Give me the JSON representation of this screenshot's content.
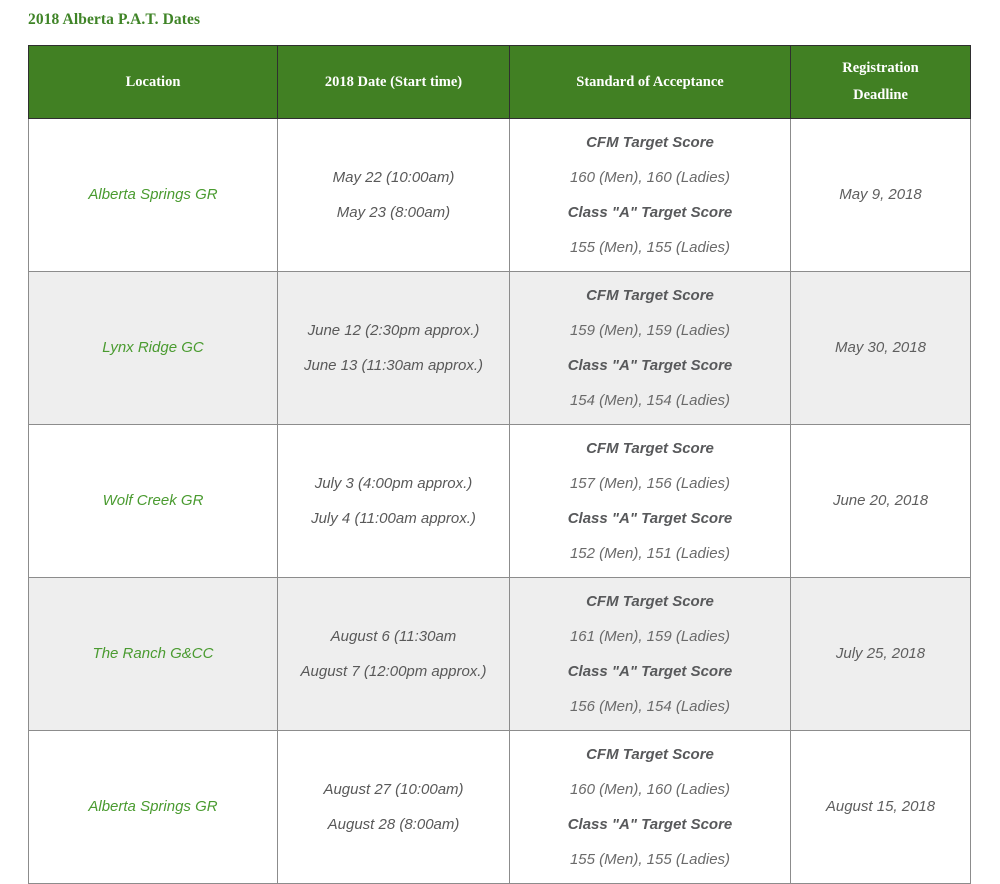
{
  "page": {
    "title": "2018 Alberta P.A.T. Dates",
    "title_color": "#3f8427",
    "background": "#ffffff"
  },
  "table": {
    "header_background": "#418023",
    "header_text_color": "#ffffff",
    "stripe_background": "#eeeeee",
    "location_text_color": "#4a9b30",
    "body_text_color": "#595959",
    "columns": [
      {
        "key": "location",
        "label": "Location"
      },
      {
        "key": "date",
        "label": "2018 Date (Start time)"
      },
      {
        "key": "standard",
        "label": "Standard of Acceptance"
      },
      {
        "key": "deadline",
        "label_line1": "Registration",
        "label_line2": "Deadline"
      }
    ],
    "rows": [
      {
        "location": "Alberta Springs GR",
        "dates": [
          "May 22 (10:00am)",
          "May 23 (8:00am)"
        ],
        "standard": {
          "cfm_label": "CFM Target Score",
          "cfm_value": "160 (Men), 160 (Ladies)",
          "class_a_label": "Class \"A\" Target Score",
          "class_a_value": "155 (Men), 155 (Ladies)"
        },
        "deadline": "May 9, 2018",
        "striped": false
      },
      {
        "location": "Lynx Ridge GC",
        "dates": [
          "June 12 (2:30pm approx.)",
          "June 13 (11:30am approx.)"
        ],
        "standard": {
          "cfm_label": "CFM Target Score",
          "cfm_value": "159 (Men), 159 (Ladies)",
          "class_a_label": "Class \"A\" Target Score",
          "class_a_value": "154 (Men), 154 (Ladies)"
        },
        "deadline": "May 30, 2018",
        "striped": true
      },
      {
        "location": "Wolf Creek GR",
        "dates": [
          "July 3 (4:00pm approx.)",
          "July 4 (11:00am approx.)"
        ],
        "standard": {
          "cfm_label": "CFM Target Score",
          "cfm_value": "157 (Men), 156 (Ladies)",
          "class_a_label": "Class \"A\" Target Score",
          "class_a_value": "152 (Men), 151 (Ladies)"
        },
        "deadline": "June 20, 2018",
        "striped": false
      },
      {
        "location": "The Ranch G&CC",
        "dates": [
          "August 6 (11:30am",
          "August 7 (12:00pm approx.)"
        ],
        "standard": {
          "cfm_label": "CFM Target Score",
          "cfm_value": "161 (Men), 159 (Ladies)",
          "class_a_label": "Class \"A\" Target Score",
          "class_a_value": "156 (Men), 154 (Ladies)"
        },
        "deadline": "July 25, 2018",
        "striped": true
      },
      {
        "location": "Alberta Springs GR",
        "dates": [
          "August 27 (10:00am)",
          "August 28 (8:00am)"
        ],
        "standard": {
          "cfm_label": "CFM Target Score",
          "cfm_value": "160 (Men), 160 (Ladies)",
          "class_a_label": "Class \"A\" Target Score",
          "class_a_value": "155 (Men), 155 (Ladies)"
        },
        "deadline": "August 15, 2018",
        "striped": false
      }
    ]
  }
}
